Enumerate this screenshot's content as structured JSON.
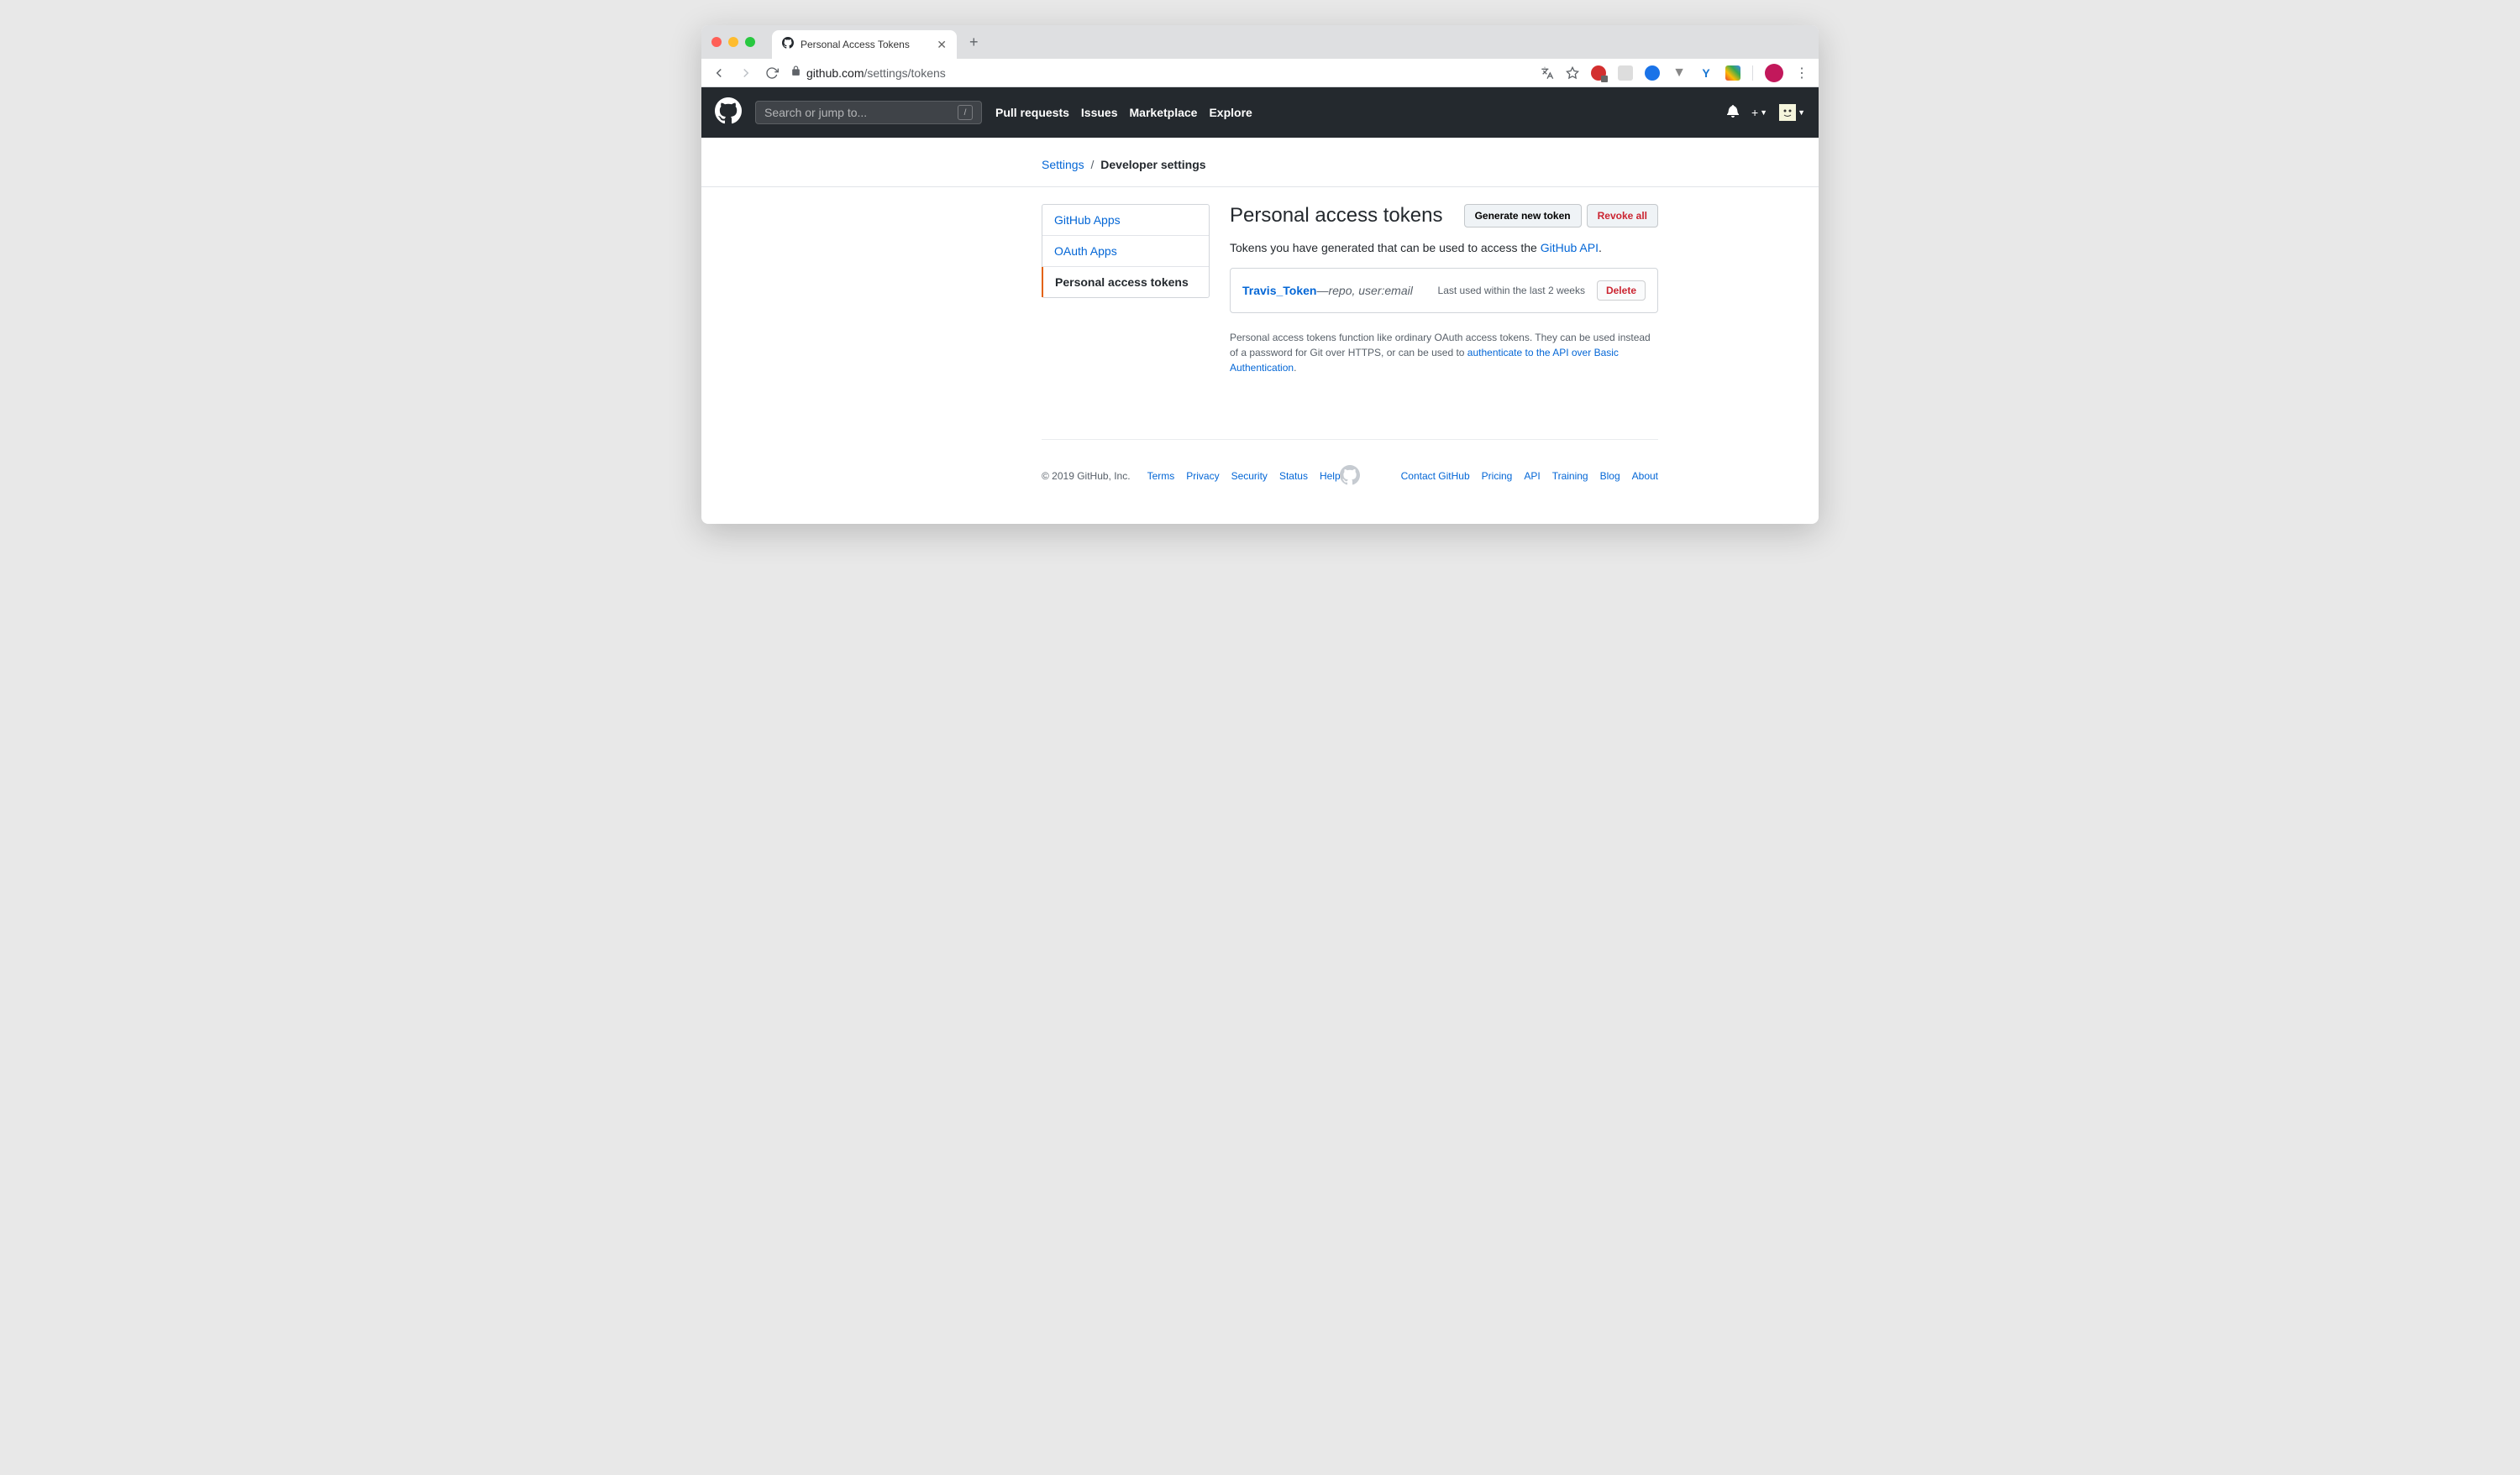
{
  "browser": {
    "tab_title": "Personal Access Tokens",
    "url_domain": "github.com",
    "url_path": "/settings/tokens"
  },
  "gh_header": {
    "search_placeholder": "Search or jump to...",
    "nav": {
      "pull_requests": "Pull requests",
      "issues": "Issues",
      "marketplace": "Marketplace",
      "explore": "Explore"
    }
  },
  "breadcrumb": {
    "settings": "Settings",
    "developer_settings": "Developer settings"
  },
  "sidebar": {
    "items": [
      {
        "label": "GitHub Apps"
      },
      {
        "label": "OAuth Apps"
      },
      {
        "label": "Personal access tokens"
      }
    ]
  },
  "main": {
    "title": "Personal access tokens",
    "generate_btn": "Generate new token",
    "revoke_btn": "Revoke all",
    "intro_text": "Tokens you have generated that can be used to access the ",
    "intro_link": "GitHub API",
    "intro_period": ".",
    "token": {
      "name": "Travis_Token",
      "dash": " — ",
      "scopes": "repo, user:email",
      "last_used": "Last used within the last 2 weeks",
      "delete": "Delete"
    },
    "help_text_1": "Personal access tokens function like ordinary OAuth access tokens. They can be used instead of a password for Git over HTTPS, or can be used to ",
    "help_link": "authenticate to the API over Basic Authentication",
    "help_text_2": "."
  },
  "footer": {
    "copyright": "© 2019 GitHub, Inc.",
    "left": {
      "terms": "Terms",
      "privacy": "Privacy",
      "security": "Security",
      "status": "Status",
      "help": "Help"
    },
    "right": {
      "contact": "Contact GitHub",
      "pricing": "Pricing",
      "api": "API",
      "training": "Training",
      "blog": "Blog",
      "about": "About"
    }
  }
}
